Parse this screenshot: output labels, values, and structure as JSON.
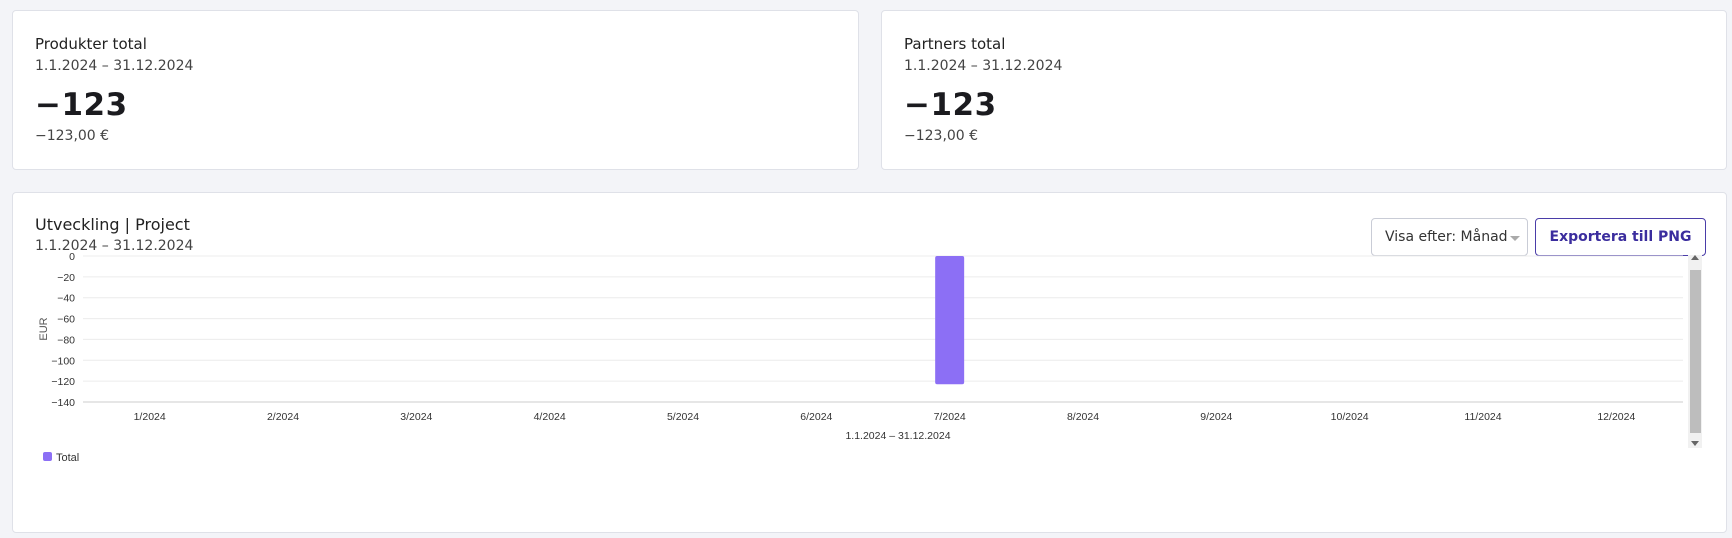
{
  "cards": [
    {
      "title": "Produkter total",
      "period": "1.1.2024 – 31.12.2024",
      "count": "−123",
      "amount": "−123,00 €"
    },
    {
      "title": "Partners total",
      "period": "1.1.2024 – 31.12.2024",
      "count": "−123",
      "amount": "−123,00 €"
    }
  ],
  "chart_panel": {
    "title": "Utveckling | Project",
    "period": "1.1.2024 – 31.12.2024",
    "view_select": "Visa efter: Månad",
    "export_label": "Exportera till PNG"
  },
  "colors": {
    "bar": "#8c6ff5",
    "accent": "#3b2d9e"
  },
  "chart_data": {
    "type": "bar",
    "categories": [
      "1/2024",
      "2/2024",
      "3/2024",
      "4/2024",
      "5/2024",
      "6/2024",
      "7/2024",
      "8/2024",
      "9/2024",
      "10/2024",
      "11/2024",
      "12/2024"
    ],
    "series": [
      {
        "name": "Total",
        "values": [
          0,
          0,
          0,
          0,
          0,
          0,
          -123,
          0,
          0,
          0,
          0,
          0
        ]
      }
    ],
    "ylabel": "EUR",
    "xlabel": "1.1.2024 – 31.12.2024",
    "ylim": [
      -140,
      0
    ],
    "yticks": [
      0,
      -20,
      -40,
      -60,
      -80,
      -100,
      -120,
      -140
    ],
    "grid": true,
    "legend_position": "bottom-left"
  }
}
